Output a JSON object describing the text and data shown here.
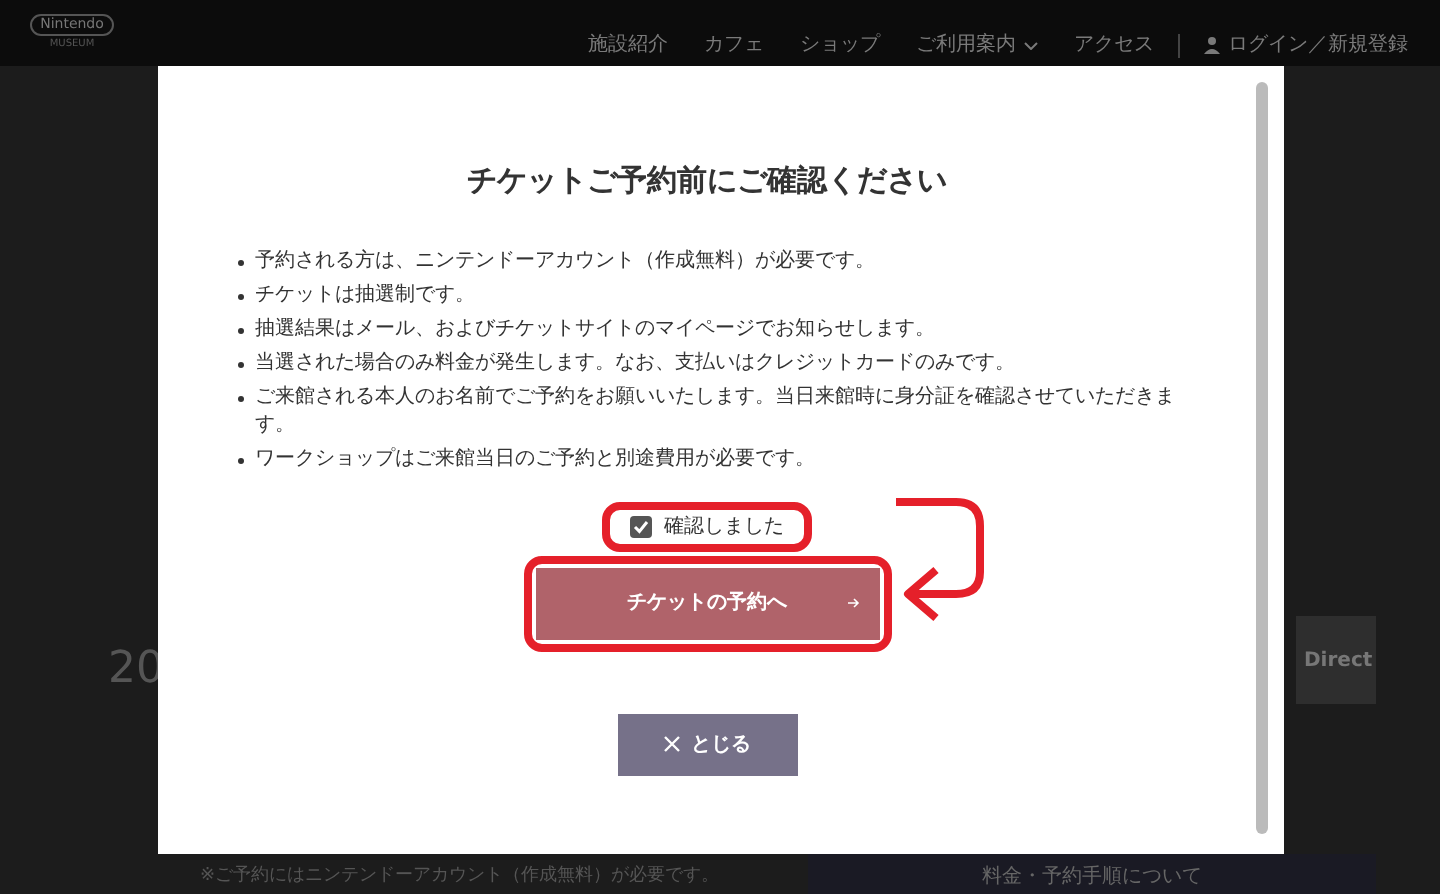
{
  "header": {
    "logo": "Nintendo",
    "logo_sub": "MUSEUM",
    "nav": [
      {
        "label": "施設紹介",
        "has_menu": false
      },
      {
        "label": "カフェ",
        "has_menu": false
      },
      {
        "label": "ショップ",
        "has_menu": false
      },
      {
        "label": "ご利用案内",
        "has_menu": true
      },
      {
        "label": "アクセス",
        "has_menu": false
      }
    ],
    "login": "ログイン／新規登録"
  },
  "background": {
    "heading": "20",
    "direct": "Direct",
    "info_link": "料金・予約手順について",
    "footnote": "※ご予約にはニンテンドーアカウント（作成無料）が必要です。"
  },
  "modal": {
    "title": "チケットご予約前にご確認ください",
    "notes": [
      "予約される方は、ニンテンドーアカウント（作成無料）が必要です。",
      "チケットは抽選制です。",
      "抽選結果はメール、およびチケットサイトのマイページでお知らせします。",
      "当選された場合のみ料金が発生します。なお、支払いはクレジットカードのみです。",
      "ご来館される本人のお名前でご予約をお願いいたします。当日来館時に身分証を確認させていただきます。",
      "ワークショップはご来館当日のご予約と別途費用が必要です。"
    ],
    "confirm": {
      "label": "確認しました",
      "checked": true
    },
    "reserve_button": "チケットの予約へ",
    "close_button": "とじる"
  }
}
